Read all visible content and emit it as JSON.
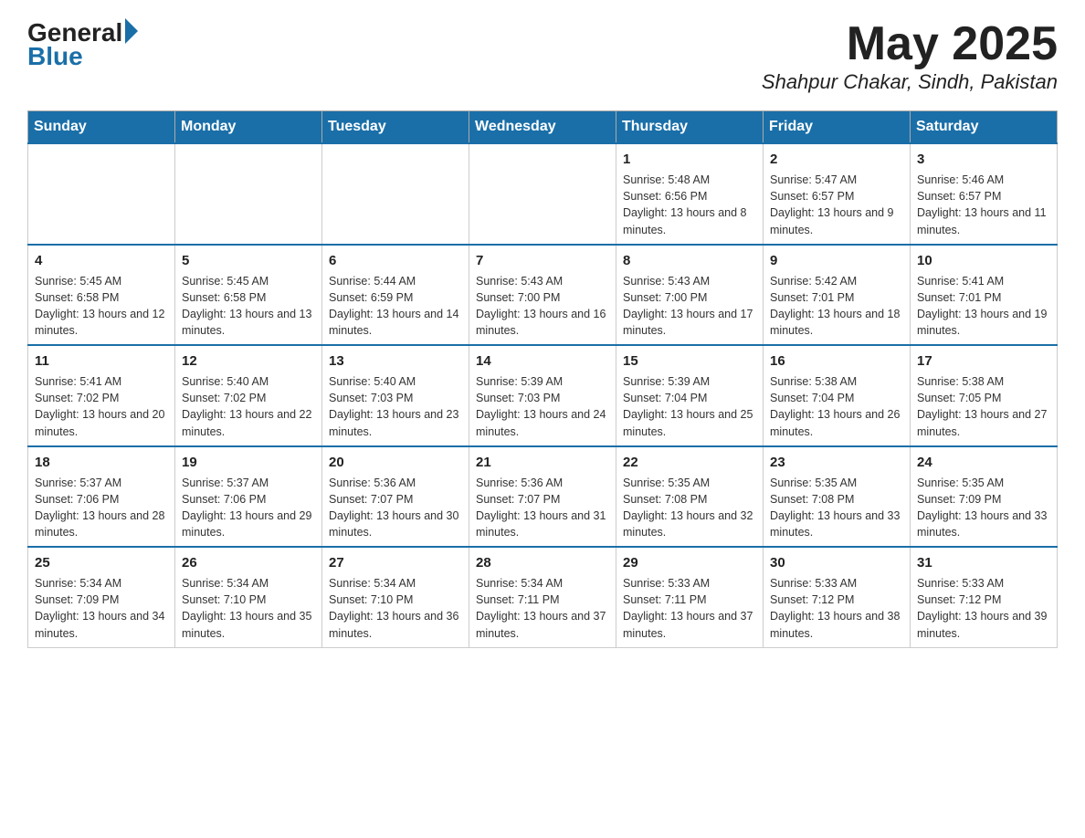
{
  "header": {
    "title": "May 2025",
    "location": "Shahpur Chakar, Sindh, Pakistan",
    "logo_general": "General",
    "logo_blue": "Blue"
  },
  "weekdays": [
    "Sunday",
    "Monday",
    "Tuesday",
    "Wednesday",
    "Thursday",
    "Friday",
    "Saturday"
  ],
  "weeks": [
    [
      {
        "day": "",
        "info": ""
      },
      {
        "day": "",
        "info": ""
      },
      {
        "day": "",
        "info": ""
      },
      {
        "day": "",
        "info": ""
      },
      {
        "day": "1",
        "info": "Sunrise: 5:48 AM\nSunset: 6:56 PM\nDaylight: 13 hours and 8 minutes."
      },
      {
        "day": "2",
        "info": "Sunrise: 5:47 AM\nSunset: 6:57 PM\nDaylight: 13 hours and 9 minutes."
      },
      {
        "day": "3",
        "info": "Sunrise: 5:46 AM\nSunset: 6:57 PM\nDaylight: 13 hours and 11 minutes."
      }
    ],
    [
      {
        "day": "4",
        "info": "Sunrise: 5:45 AM\nSunset: 6:58 PM\nDaylight: 13 hours and 12 minutes."
      },
      {
        "day": "5",
        "info": "Sunrise: 5:45 AM\nSunset: 6:58 PM\nDaylight: 13 hours and 13 minutes."
      },
      {
        "day": "6",
        "info": "Sunrise: 5:44 AM\nSunset: 6:59 PM\nDaylight: 13 hours and 14 minutes."
      },
      {
        "day": "7",
        "info": "Sunrise: 5:43 AM\nSunset: 7:00 PM\nDaylight: 13 hours and 16 minutes."
      },
      {
        "day": "8",
        "info": "Sunrise: 5:43 AM\nSunset: 7:00 PM\nDaylight: 13 hours and 17 minutes."
      },
      {
        "day": "9",
        "info": "Sunrise: 5:42 AM\nSunset: 7:01 PM\nDaylight: 13 hours and 18 minutes."
      },
      {
        "day": "10",
        "info": "Sunrise: 5:41 AM\nSunset: 7:01 PM\nDaylight: 13 hours and 19 minutes."
      }
    ],
    [
      {
        "day": "11",
        "info": "Sunrise: 5:41 AM\nSunset: 7:02 PM\nDaylight: 13 hours and 20 minutes."
      },
      {
        "day": "12",
        "info": "Sunrise: 5:40 AM\nSunset: 7:02 PM\nDaylight: 13 hours and 22 minutes."
      },
      {
        "day": "13",
        "info": "Sunrise: 5:40 AM\nSunset: 7:03 PM\nDaylight: 13 hours and 23 minutes."
      },
      {
        "day": "14",
        "info": "Sunrise: 5:39 AM\nSunset: 7:03 PM\nDaylight: 13 hours and 24 minutes."
      },
      {
        "day": "15",
        "info": "Sunrise: 5:39 AM\nSunset: 7:04 PM\nDaylight: 13 hours and 25 minutes."
      },
      {
        "day": "16",
        "info": "Sunrise: 5:38 AM\nSunset: 7:04 PM\nDaylight: 13 hours and 26 minutes."
      },
      {
        "day": "17",
        "info": "Sunrise: 5:38 AM\nSunset: 7:05 PM\nDaylight: 13 hours and 27 minutes."
      }
    ],
    [
      {
        "day": "18",
        "info": "Sunrise: 5:37 AM\nSunset: 7:06 PM\nDaylight: 13 hours and 28 minutes."
      },
      {
        "day": "19",
        "info": "Sunrise: 5:37 AM\nSunset: 7:06 PM\nDaylight: 13 hours and 29 minutes."
      },
      {
        "day": "20",
        "info": "Sunrise: 5:36 AM\nSunset: 7:07 PM\nDaylight: 13 hours and 30 minutes."
      },
      {
        "day": "21",
        "info": "Sunrise: 5:36 AM\nSunset: 7:07 PM\nDaylight: 13 hours and 31 minutes."
      },
      {
        "day": "22",
        "info": "Sunrise: 5:35 AM\nSunset: 7:08 PM\nDaylight: 13 hours and 32 minutes."
      },
      {
        "day": "23",
        "info": "Sunrise: 5:35 AM\nSunset: 7:08 PM\nDaylight: 13 hours and 33 minutes."
      },
      {
        "day": "24",
        "info": "Sunrise: 5:35 AM\nSunset: 7:09 PM\nDaylight: 13 hours and 33 minutes."
      }
    ],
    [
      {
        "day": "25",
        "info": "Sunrise: 5:34 AM\nSunset: 7:09 PM\nDaylight: 13 hours and 34 minutes."
      },
      {
        "day": "26",
        "info": "Sunrise: 5:34 AM\nSunset: 7:10 PM\nDaylight: 13 hours and 35 minutes."
      },
      {
        "day": "27",
        "info": "Sunrise: 5:34 AM\nSunset: 7:10 PM\nDaylight: 13 hours and 36 minutes."
      },
      {
        "day": "28",
        "info": "Sunrise: 5:34 AM\nSunset: 7:11 PM\nDaylight: 13 hours and 37 minutes."
      },
      {
        "day": "29",
        "info": "Sunrise: 5:33 AM\nSunset: 7:11 PM\nDaylight: 13 hours and 37 minutes."
      },
      {
        "day": "30",
        "info": "Sunrise: 5:33 AM\nSunset: 7:12 PM\nDaylight: 13 hours and 38 minutes."
      },
      {
        "day": "31",
        "info": "Sunrise: 5:33 AM\nSunset: 7:12 PM\nDaylight: 13 hours and 39 minutes."
      }
    ]
  ]
}
